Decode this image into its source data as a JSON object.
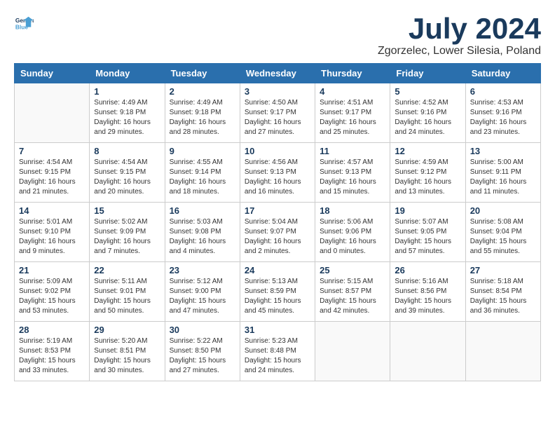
{
  "header": {
    "logo_line1": "General",
    "logo_line2": "Blue",
    "month": "July 2024",
    "location": "Zgorzelec, Lower Silesia, Poland"
  },
  "weekdays": [
    "Sunday",
    "Monday",
    "Tuesday",
    "Wednesday",
    "Thursday",
    "Friday",
    "Saturday"
  ],
  "weeks": [
    [
      {
        "day": "",
        "info": ""
      },
      {
        "day": "1",
        "info": "Sunrise: 4:49 AM\nSunset: 9:18 PM\nDaylight: 16 hours\nand 29 minutes."
      },
      {
        "day": "2",
        "info": "Sunrise: 4:49 AM\nSunset: 9:18 PM\nDaylight: 16 hours\nand 28 minutes."
      },
      {
        "day": "3",
        "info": "Sunrise: 4:50 AM\nSunset: 9:17 PM\nDaylight: 16 hours\nand 27 minutes."
      },
      {
        "day": "4",
        "info": "Sunrise: 4:51 AM\nSunset: 9:17 PM\nDaylight: 16 hours\nand 25 minutes."
      },
      {
        "day": "5",
        "info": "Sunrise: 4:52 AM\nSunset: 9:16 PM\nDaylight: 16 hours\nand 24 minutes."
      },
      {
        "day": "6",
        "info": "Sunrise: 4:53 AM\nSunset: 9:16 PM\nDaylight: 16 hours\nand 23 minutes."
      }
    ],
    [
      {
        "day": "7",
        "info": "Sunrise: 4:54 AM\nSunset: 9:15 PM\nDaylight: 16 hours\nand 21 minutes."
      },
      {
        "day": "8",
        "info": "Sunrise: 4:54 AM\nSunset: 9:15 PM\nDaylight: 16 hours\nand 20 minutes."
      },
      {
        "day": "9",
        "info": "Sunrise: 4:55 AM\nSunset: 9:14 PM\nDaylight: 16 hours\nand 18 minutes."
      },
      {
        "day": "10",
        "info": "Sunrise: 4:56 AM\nSunset: 9:13 PM\nDaylight: 16 hours\nand 16 minutes."
      },
      {
        "day": "11",
        "info": "Sunrise: 4:57 AM\nSunset: 9:13 PM\nDaylight: 16 hours\nand 15 minutes."
      },
      {
        "day": "12",
        "info": "Sunrise: 4:59 AM\nSunset: 9:12 PM\nDaylight: 16 hours\nand 13 minutes."
      },
      {
        "day": "13",
        "info": "Sunrise: 5:00 AM\nSunset: 9:11 PM\nDaylight: 16 hours\nand 11 minutes."
      }
    ],
    [
      {
        "day": "14",
        "info": "Sunrise: 5:01 AM\nSunset: 9:10 PM\nDaylight: 16 hours\nand 9 minutes."
      },
      {
        "day": "15",
        "info": "Sunrise: 5:02 AM\nSunset: 9:09 PM\nDaylight: 16 hours\nand 7 minutes."
      },
      {
        "day": "16",
        "info": "Sunrise: 5:03 AM\nSunset: 9:08 PM\nDaylight: 16 hours\nand 4 minutes."
      },
      {
        "day": "17",
        "info": "Sunrise: 5:04 AM\nSunset: 9:07 PM\nDaylight: 16 hours\nand 2 minutes."
      },
      {
        "day": "18",
        "info": "Sunrise: 5:06 AM\nSunset: 9:06 PM\nDaylight: 16 hours\nand 0 minutes."
      },
      {
        "day": "19",
        "info": "Sunrise: 5:07 AM\nSunset: 9:05 PM\nDaylight: 15 hours\nand 57 minutes."
      },
      {
        "day": "20",
        "info": "Sunrise: 5:08 AM\nSunset: 9:04 PM\nDaylight: 15 hours\nand 55 minutes."
      }
    ],
    [
      {
        "day": "21",
        "info": "Sunrise: 5:09 AM\nSunset: 9:02 PM\nDaylight: 15 hours\nand 53 minutes."
      },
      {
        "day": "22",
        "info": "Sunrise: 5:11 AM\nSunset: 9:01 PM\nDaylight: 15 hours\nand 50 minutes."
      },
      {
        "day": "23",
        "info": "Sunrise: 5:12 AM\nSunset: 9:00 PM\nDaylight: 15 hours\nand 47 minutes."
      },
      {
        "day": "24",
        "info": "Sunrise: 5:13 AM\nSunset: 8:59 PM\nDaylight: 15 hours\nand 45 minutes."
      },
      {
        "day": "25",
        "info": "Sunrise: 5:15 AM\nSunset: 8:57 PM\nDaylight: 15 hours\nand 42 minutes."
      },
      {
        "day": "26",
        "info": "Sunrise: 5:16 AM\nSunset: 8:56 PM\nDaylight: 15 hours\nand 39 minutes."
      },
      {
        "day": "27",
        "info": "Sunrise: 5:18 AM\nSunset: 8:54 PM\nDaylight: 15 hours\nand 36 minutes."
      }
    ],
    [
      {
        "day": "28",
        "info": "Sunrise: 5:19 AM\nSunset: 8:53 PM\nDaylight: 15 hours\nand 33 minutes."
      },
      {
        "day": "29",
        "info": "Sunrise: 5:20 AM\nSunset: 8:51 PM\nDaylight: 15 hours\nand 30 minutes."
      },
      {
        "day": "30",
        "info": "Sunrise: 5:22 AM\nSunset: 8:50 PM\nDaylight: 15 hours\nand 27 minutes."
      },
      {
        "day": "31",
        "info": "Sunrise: 5:23 AM\nSunset: 8:48 PM\nDaylight: 15 hours\nand 24 minutes."
      },
      {
        "day": "",
        "info": ""
      },
      {
        "day": "",
        "info": ""
      },
      {
        "day": "",
        "info": ""
      }
    ]
  ]
}
